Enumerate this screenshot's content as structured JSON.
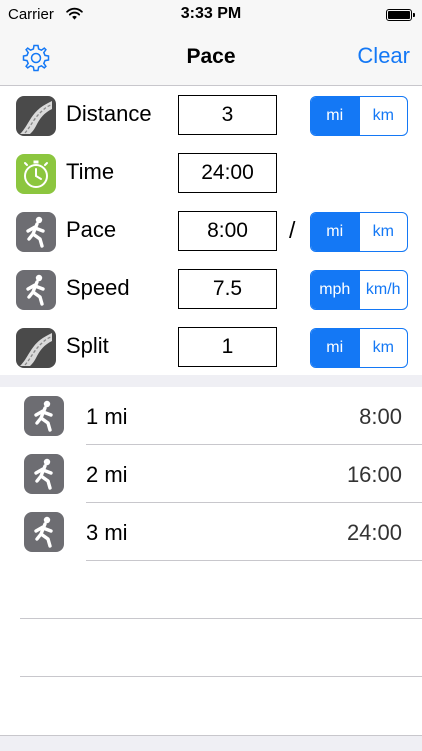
{
  "status_bar": {
    "carrier": "Carrier",
    "time": "3:33 PM"
  },
  "nav": {
    "title": "Pace",
    "clear_label": "Clear"
  },
  "rows": [
    {
      "label": "Distance",
      "value": "3",
      "icon": "road-icon",
      "units": [
        "mi",
        "km"
      ],
      "selected": "mi"
    },
    {
      "label": "Time",
      "value": "24:00",
      "icon": "stopwatch-icon"
    },
    {
      "label": "Pace",
      "value": "8:00",
      "icon": "runner-icon",
      "separator": "/",
      "units": [
        "mi",
        "km"
      ],
      "selected": "mi"
    },
    {
      "label": "Speed",
      "value": "7.5",
      "icon": "runner-icon",
      "units": [
        "mph",
        "km/h"
      ],
      "selected": "mph"
    },
    {
      "label": "Split",
      "value": "1",
      "icon": "road-icon",
      "units": [
        "mi",
        "km"
      ],
      "selected": "mi"
    }
  ],
  "splits": [
    {
      "distance": "1 mi",
      "time": "8:00",
      "icon": "runner-icon"
    },
    {
      "distance": "2 mi",
      "time": "16:00",
      "icon": "runner-icon"
    },
    {
      "distance": "3 mi",
      "time": "24:00",
      "icon": "runner-icon"
    }
  ],
  "colors": {
    "accent": "#1478f5",
    "timer_green": "#8cc63f",
    "icon_gray": "#6d6d72",
    "road_dark": "#4a4a4a"
  }
}
